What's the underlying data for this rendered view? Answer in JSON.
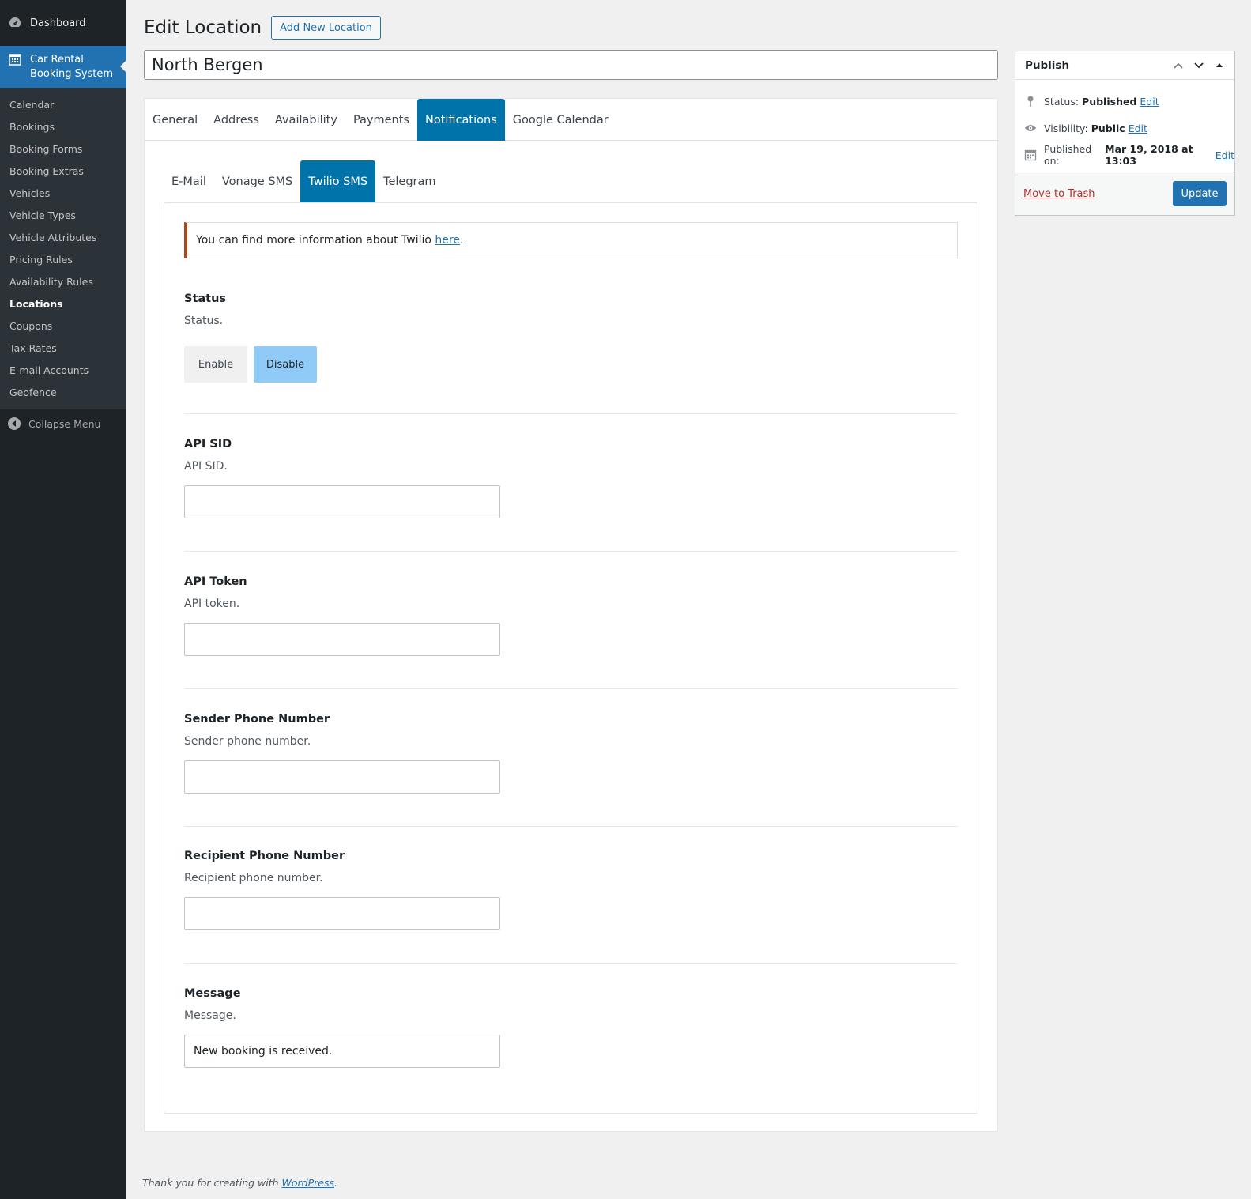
{
  "sidebar": {
    "dashboard_label": "Dashboard",
    "active_label_line1": "Car Rental",
    "active_label_line2": "Booking System",
    "items": [
      {
        "label": "Calendar"
      },
      {
        "label": "Bookings"
      },
      {
        "label": "Booking Forms"
      },
      {
        "label": "Booking Extras"
      },
      {
        "label": "Vehicles"
      },
      {
        "label": "Vehicle Types"
      },
      {
        "label": "Vehicle Attributes"
      },
      {
        "label": "Pricing Rules"
      },
      {
        "label": "Availability Rules"
      },
      {
        "label": "Locations"
      },
      {
        "label": "Coupons"
      },
      {
        "label": "Tax Rates"
      },
      {
        "label": "E-mail Accounts"
      },
      {
        "label": "Geofence"
      }
    ],
    "collapse_label": "Collapse Menu"
  },
  "header": {
    "title": "Edit Location",
    "add_new_label": "Add New Location"
  },
  "post_title": "North Bergen",
  "tabs": [
    {
      "label": "General"
    },
    {
      "label": "Address"
    },
    {
      "label": "Availability"
    },
    {
      "label": "Payments"
    },
    {
      "label": "Notifications"
    },
    {
      "label": "Google Calendar"
    }
  ],
  "subtabs": [
    {
      "label": "E-Mail"
    },
    {
      "label": "Vonage SMS"
    },
    {
      "label": "Twilio SMS"
    },
    {
      "label": "Telegram"
    }
  ],
  "notice": {
    "text": "You can find more information about Twilio ",
    "link": "here",
    "suffix": "."
  },
  "status_field": {
    "label": "Status",
    "desc": "Status.",
    "enable_label": "Enable",
    "disable_label": "Disable"
  },
  "api_sid": {
    "label": "API SID",
    "desc": "API SID.",
    "value": ""
  },
  "api_token": {
    "label": "API Token",
    "desc": "API token.",
    "value": ""
  },
  "sender_phone": {
    "label": "Sender Phone Number",
    "desc": "Sender phone number.",
    "value": ""
  },
  "recipient_phone": {
    "label": "Recipient Phone Number",
    "desc": "Recipient phone number.",
    "value": ""
  },
  "message": {
    "label": "Message",
    "desc": "Message.",
    "value": "New booking is received."
  },
  "publish": {
    "title": "Publish",
    "status_label": "Status:",
    "status_value": "Published",
    "visibility_label": "Visibility:",
    "visibility_value": "Public",
    "published_label": "Published on:",
    "published_value": "Mar 19, 2018 at 13:03",
    "edit_label": "Edit",
    "trash_label": "Move to Trash",
    "update_label": "Update"
  },
  "footer": {
    "text": "Thank you for creating with ",
    "link": "WordPress",
    "suffix": "."
  },
  "colors": {
    "accent": "#2271b1",
    "tab_active": "#0073aa",
    "sidebar_bg": "#1d2327",
    "notice_border": "#b0461b",
    "disable_bg": "#90cbf7"
  }
}
